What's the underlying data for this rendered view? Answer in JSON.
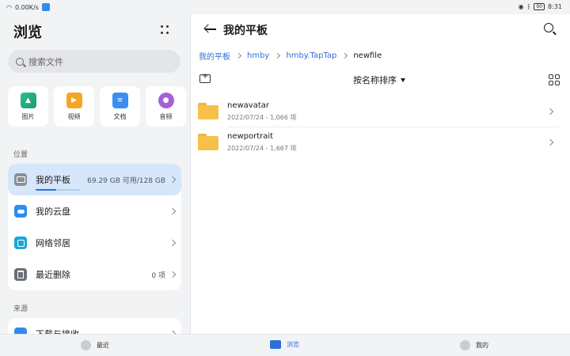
{
  "status_bar": {
    "net_speed": "0.00K/s",
    "battery": "90",
    "time": "8:31"
  },
  "left": {
    "title": "浏览",
    "search_placeholder": "搜索文件",
    "categories": [
      {
        "label": "图片",
        "icon": "image-icon"
      },
      {
        "label": "视频",
        "icon": "video-icon"
      },
      {
        "label": "文档",
        "icon": "document-icon"
      },
      {
        "label": "音频",
        "icon": "audio-icon"
      }
    ],
    "locations_header": "位置",
    "locations": [
      {
        "label": "我的平板",
        "meta": "69.29 GB 可用/128 GB",
        "icon": "tablet-icon",
        "usage_fraction": 0.46
      },
      {
        "label": "我的云盘",
        "meta": "",
        "icon": "cloud-icon"
      },
      {
        "label": "网络邻居",
        "meta": "",
        "icon": "network-icon"
      },
      {
        "label": "最近删除",
        "meta": "0 项",
        "icon": "trash-icon"
      }
    ],
    "sources_header": "来源",
    "sources": [
      {
        "label": "下载与接收",
        "icon": "download-icon"
      }
    ]
  },
  "right": {
    "title": "我的平板",
    "breadcrumbs": [
      "我的平板",
      "hmby",
      "hmby.TapTap",
      "newfile"
    ],
    "sort_label": "按名称排序",
    "files": [
      {
        "name": "newavatar",
        "meta": "2022/07/24 - 1,066 项"
      },
      {
        "name": "newportrait",
        "meta": "2022/07/24 - 1,667 项"
      }
    ]
  },
  "tabbar": {
    "tabs": [
      {
        "label": "最近",
        "icon": "clock-icon"
      },
      {
        "label": "浏览",
        "icon": "folder-icon"
      },
      {
        "label": "我的",
        "icon": "user-icon"
      }
    ]
  },
  "colors": {
    "accent": "#2f6fd8",
    "folder": "#f7c04a",
    "selected_row": "#d6e6fb"
  }
}
